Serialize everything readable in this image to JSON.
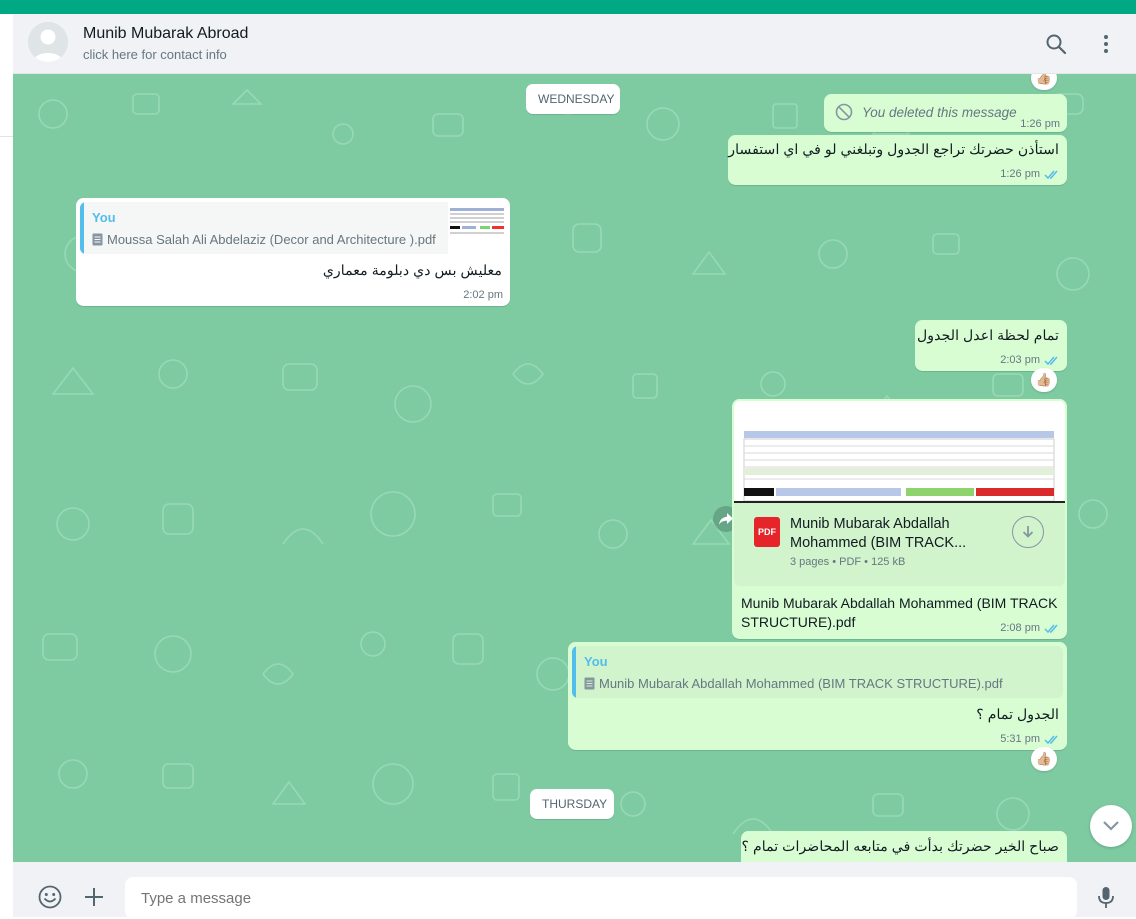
{
  "header": {
    "contact_name": "Munib Mubarak Abroad",
    "contact_sub": "click here for contact info",
    "icons": [
      "search-icon",
      "menu-icon"
    ]
  },
  "colors": {
    "accent": "#00a884",
    "chat_bg": "#7ecba2",
    "outgoing_bubble": "#d9fdd3",
    "incoming_bubble": "#ffffff",
    "read_tick": "#53bdeb"
  },
  "chat": {
    "day_wednesday": "WEDNESDAY",
    "day_thursday": "THURSDAY",
    "deleted": {
      "text": "You deleted this message",
      "time": "1:26 pm"
    },
    "msg1": {
      "text": "استأذن حضرتك تراجع الجدول وتبلغني لو في اي استفسار",
      "time": "1:26 pm"
    },
    "msg2": {
      "quote_author": "You",
      "quote_file": "Moussa Salah Ali Abdelaziz (Decor and Architecture ).pdf",
      "text": "معليش بس دي دبلومة معماري",
      "time": "2:02 pm"
    },
    "msg3": {
      "text": "تمام لحظة اعدل الجدول",
      "time": "2:03 pm",
      "reaction": "👍🏼"
    },
    "msg4": {
      "file_name_line1": "Munib Mubarak Abdallah",
      "file_name_line2": "Mohammed (BIM TRACK...",
      "file_info": "3 pages • PDF • 125 kB",
      "file_type": "PDF",
      "caption_line1": "Munib Mubarak Abdallah Mohammed (BIM TRACK",
      "caption_line2": "STRUCTURE).pdf",
      "time": "2:08 pm"
    },
    "msg5": {
      "quote_author": "You",
      "quote_file": "Munib Mubarak Abdallah Mohammed (BIM TRACK STRUCTURE).pdf",
      "text": "الجدول تمام ؟",
      "time": "5:31 pm",
      "reaction": "👍🏼"
    },
    "msg6": {
      "text": "صباح الخير حضرتك بدأت في متابعه المحاضرات تمام ؟"
    },
    "top_reaction": "👍🏼"
  },
  "footer": {
    "placeholder": "Type a message",
    "icons": [
      "emoji-icon",
      "attach-icon",
      "mic-icon"
    ]
  }
}
